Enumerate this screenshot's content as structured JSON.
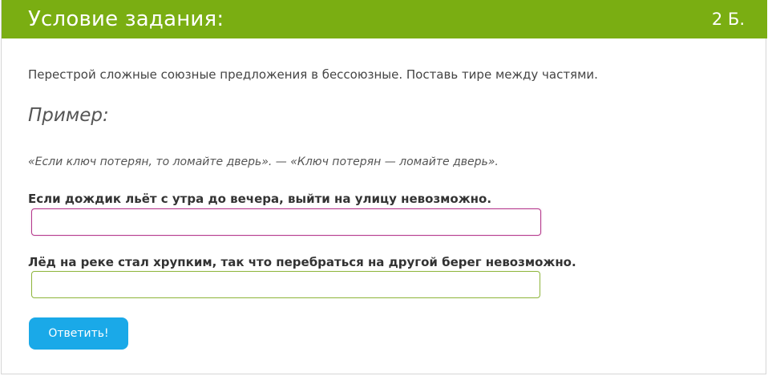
{
  "header": {
    "title": "Условие задания:",
    "points": "2 Б."
  },
  "task": {
    "instruction": "Перестрой сложные союзные предложения в бессоюзные. Поставь тире между частями.",
    "example_heading": "Пример:",
    "example_text": "«Если ключ потерян, то ломайте дверь». — «Ключ потерян — ломайте дверь»."
  },
  "questions": [
    {
      "sentence": "Если дождик льёт с утра до вечера, выйти на улицу невозможно.",
      "answer_value": ""
    },
    {
      "sentence": "Лёд на реке стал хрупким, так что перебраться на другой берег невозможно.",
      "answer_value": ""
    }
  ],
  "submit": {
    "label": "Ответить!"
  },
  "colors": {
    "header_bg": "#7aae12",
    "button_bg": "#1aa9e8",
    "focused_input_border": "#b5388c",
    "input_border": "#8db43a"
  }
}
